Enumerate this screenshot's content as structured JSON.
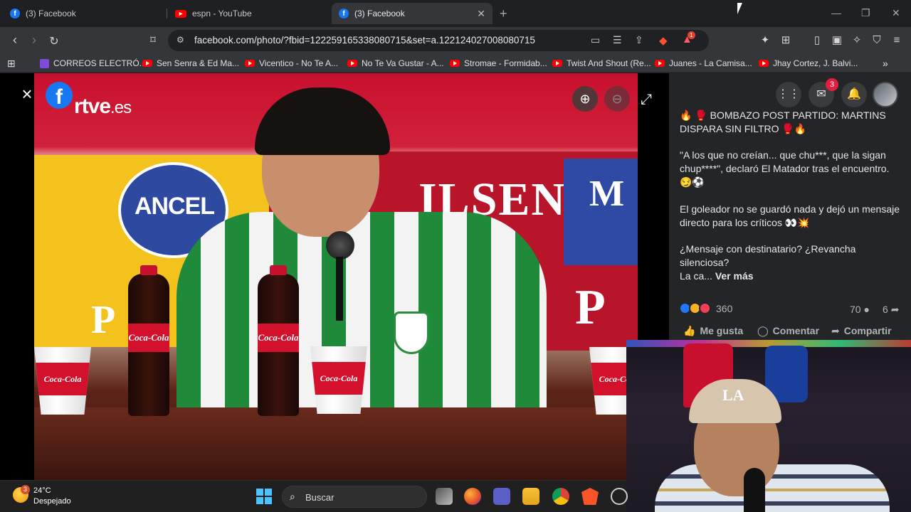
{
  "browser": {
    "tabs": [
      {
        "title": "(3) Facebook",
        "favicon": "facebook-icon",
        "active": false
      },
      {
        "title": "espn - YouTube",
        "favicon": "youtube-icon",
        "active": false
      },
      {
        "title": "(3) Facebook",
        "favicon": "facebook-icon",
        "active": true
      }
    ],
    "new_tab_glyph": "+",
    "url": "facebook.com/photo/?fbid=122259165338080715&set=a.122124027008080715",
    "brave_rewards_badge": "1",
    "bookmarks": [
      {
        "label": "CORREOS ELECTRÓ...",
        "icon": "list-icon"
      },
      {
        "label": "Sen Senra & Ed Ma...",
        "icon": "youtube-icon"
      },
      {
        "label": "Vicentico - No Te A...",
        "icon": "youtube-icon"
      },
      {
        "label": "No Te Va Gustar - A...",
        "icon": "youtube-icon"
      },
      {
        "label": "Stromae - Formidab...",
        "icon": "youtube-icon"
      },
      {
        "label": "Twist And Shout (Re...",
        "icon": "youtube-icon"
      },
      {
        "label": "Juanes - La Camisa...",
        "icon": "youtube-icon"
      },
      {
        "label": "Jhay Cortez, J. Balvi...",
        "icon": "youtube-icon"
      }
    ],
    "bookmarks_more": "»"
  },
  "viewer": {
    "close_glyph": "×",
    "fb_logo": "f",
    "watermark_main": "rtve",
    "watermark_suffix": ".es",
    "photo_signage": {
      "ancel": "ANCEL",
      "pilsen": "ILSEN",
      "m": "M",
      "p_left": "P",
      "p_right": "P",
      "bottle_brand": "Coca-Cola"
    }
  },
  "facebook": {
    "messenger_badge": "3",
    "post": {
      "line1": "🔥 🥊 BOMBAZO POST PARTIDO: MARTINS DISPARA SIN FILTRO 🥊🔥",
      "line2": "\"A los que no creían... que chu***, que la sigan chup****\", declaró El Matador tras el encuentro. 😏⚽",
      "line3": "El goleador no se guardó nada y dejó un mensaje directo para los críticos 👀💥",
      "line4": "¿Mensaje con destinatario? ¿Revancha silenciosa?",
      "line5_prefix": "La ca...",
      "see_more": "Ver más"
    },
    "reaction_count": "360",
    "comment_count": "70",
    "share_count": "6",
    "actions": {
      "like": "Me gusta",
      "comment": "Comentar",
      "share": "Compartir"
    }
  },
  "taskbar": {
    "weather_badge": "3",
    "temperature": "24°C",
    "condition": "Despejado",
    "search_placeholder": "Buscar"
  }
}
